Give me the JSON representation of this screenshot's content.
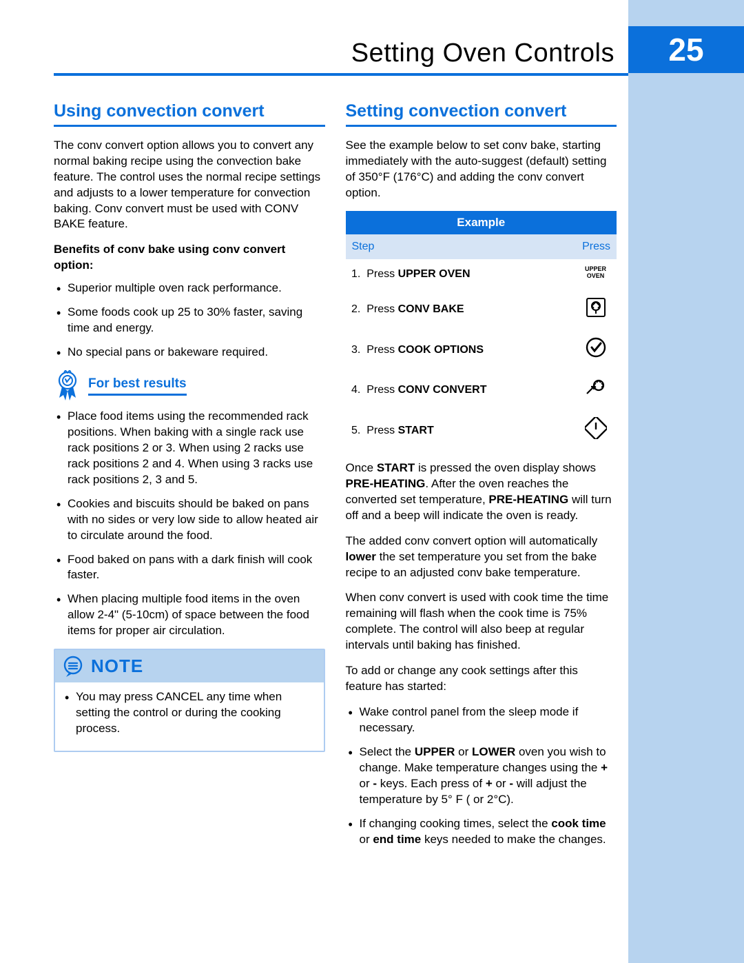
{
  "header": {
    "title": "Setting Oven Controls",
    "page_number": "25"
  },
  "left": {
    "heading": "Using convection convert",
    "intro": "The conv convert option allows you to convert any normal baking recipe using the convection bake feature. The control uses the normal recipe settings and adjusts to a lower temperature for convection baking. Conv convert must be used with CONV BAKE feature.",
    "benefits_heading": "Benefits of conv bake using conv convert option:",
    "benefits": [
      "Superior multiple oven rack performance.",
      "Some foods cook up 25 to 30% faster, saving time and energy.",
      "No special pans or bakeware required."
    ],
    "best_results_label": "For best results",
    "best_results": [
      "Place food items using the recommended rack positions. When baking with a single rack use rack positions 2 or 3. When using 2 racks use rack positions  2 and 4. When using 3 racks use rack positions 2, 3 and 5.",
      "Cookies and biscuits should be baked on pans with no sides or very low side to allow heated air to circulate around the food.",
      "Food baked on pans with a dark finish will cook faster.",
      "When placing multiple food items in the oven allow 2-4\" (5-10cm) of space between the food items for proper air circulation."
    ],
    "note_label": "NOTE",
    "note_items": [
      "You may press CANCEL any time when setting the control or during the cooking process."
    ]
  },
  "right": {
    "heading": "Setting convection convert",
    "intro": "See the example below to set conv bake, starting immediately with the auto-suggest (default) setting of 350°F (176°C) and adding the conv convert option.",
    "example": {
      "title": "Example",
      "col_step": "Step",
      "col_press": "Press",
      "rows": [
        {
          "num": "1.",
          "pre": "Press ",
          "bold": "UPPER OVEN",
          "icon": "upper-oven"
        },
        {
          "num": "2.",
          "pre": "Press ",
          "bold": "CONV BAKE",
          "icon": "conv-bake"
        },
        {
          "num": "3.",
          "pre": "Press ",
          "bold": "COOK OPTIONS",
          "icon": "cook-options"
        },
        {
          "num": "4.",
          "pre": "Press ",
          "bold": "CONV CONVERT",
          "icon": "conv-convert"
        },
        {
          "num": "5.",
          "pre": "Press ",
          "bold": "START",
          "icon": "start"
        }
      ]
    },
    "para1_a": "Once ",
    "para1_b": "START",
    "para1_c": " is pressed the oven display shows ",
    "para1_d": "PRE-HEATING",
    "para1_e": ". After the oven reaches the converted set temperature, ",
    "para1_f": "PRE-HEATING",
    "para1_g": " will turn off and a beep will indicate the oven is ready.",
    "para2_a": "The added conv convert option will automatically ",
    "para2_b": "lower",
    "para2_c": " the set temperature you set from the bake recipe to an adjusted conv bake temperature.",
    "para3": "When conv convert is used with cook time the time remaining will flash when the cook time is 75% complete. The control will also beep at regular intervals until baking has finished.",
    "para4": "To add or change any cook settings after this feature has started:",
    "change_items": {
      "i1": "Wake control panel from the sleep mode if necessary.",
      "i2_a": "Select the ",
      "i2_b": "UPPER",
      "i2_c": " or ",
      "i2_d": "LOWER",
      "i2_e": " oven you wish to change. Make temperature changes using the ",
      "i2_f": "+",
      "i2_g": " or ",
      "i2_h": "-",
      "i2_i": " keys. Each press of ",
      "i2_j": "+",
      "i2_k": " or ",
      "i2_l": "-",
      "i2_m": " will adjust the temperature by 5° F ( or 2°C).",
      "i3_a": "If changing cooking times, select the ",
      "i3_b": "cook time",
      "i3_c": " or ",
      "i3_d": "end time",
      "i3_e": " keys needed to make the changes."
    },
    "upper_oven_icon_text": "UPPER OVEN"
  }
}
